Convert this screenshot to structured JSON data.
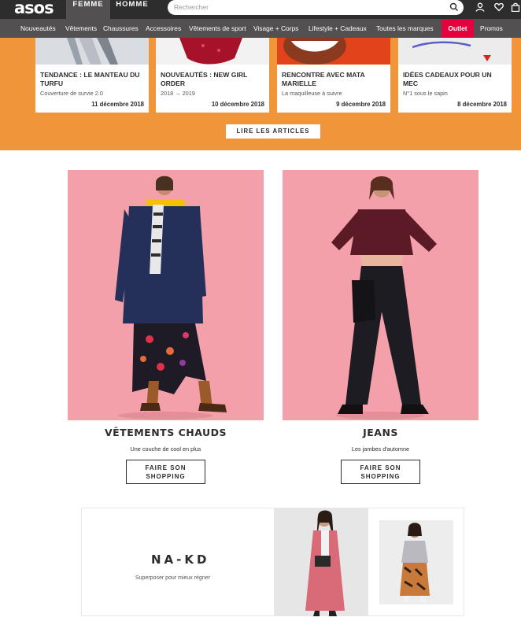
{
  "header": {
    "logo": "asos",
    "gender_tabs": [
      "FEMME",
      "HOMME"
    ],
    "search_placeholder": "Rechercher"
  },
  "nav": {
    "items": [
      "Nouveautés",
      "Vêtements",
      "Chaussures",
      "Accessoires",
      "Vêtements de sport",
      "Visage + Corps",
      "Lifestyle + Cadeaux",
      "Toutes les marques"
    ],
    "outlet": "Outlet",
    "promos": "Promos"
  },
  "articles": [
    {
      "title": "TENDANCE : LE MANTEAU DU TURFU",
      "subtitle": "Couverture de survie 2.0",
      "date": "11 décembre 2018"
    },
    {
      "title": "NOUVEAUTÉS : NEW GIRL ORDER",
      "subtitle": "2018 → 2019",
      "date": "10 décembre 2018"
    },
    {
      "title": "RENCONTRE AVEC MATA MARIELLE",
      "subtitle": "La maquilleuse à suivre",
      "date": "9 décembre 2018"
    },
    {
      "title": "IDÉES CADEAUX POUR UN MEC",
      "subtitle": "N°1 sous le sapin",
      "date": "8 décembre 2018"
    }
  ],
  "read_articles_label": "LIRE LES ARTICLES",
  "promos": [
    {
      "title": "VÊTEMENTS CHAUDS",
      "subtitle": "Une couche de cool en plus",
      "cta_line1": "FAIRE SON",
      "cta_line2": "SHOPPING"
    },
    {
      "title": "JEANS",
      "subtitle": "Les jambes d'automne",
      "cta_line1": "FAIRE SON",
      "cta_line2": "SHOPPING"
    }
  ],
  "brand_banner": {
    "logo": "NA-KD",
    "subtitle": "Superposer pour mieux régner"
  },
  "colors": {
    "orange_band": "#f0953a",
    "outlet": "#e5003e",
    "photo_pink": "#f3a0ab"
  }
}
